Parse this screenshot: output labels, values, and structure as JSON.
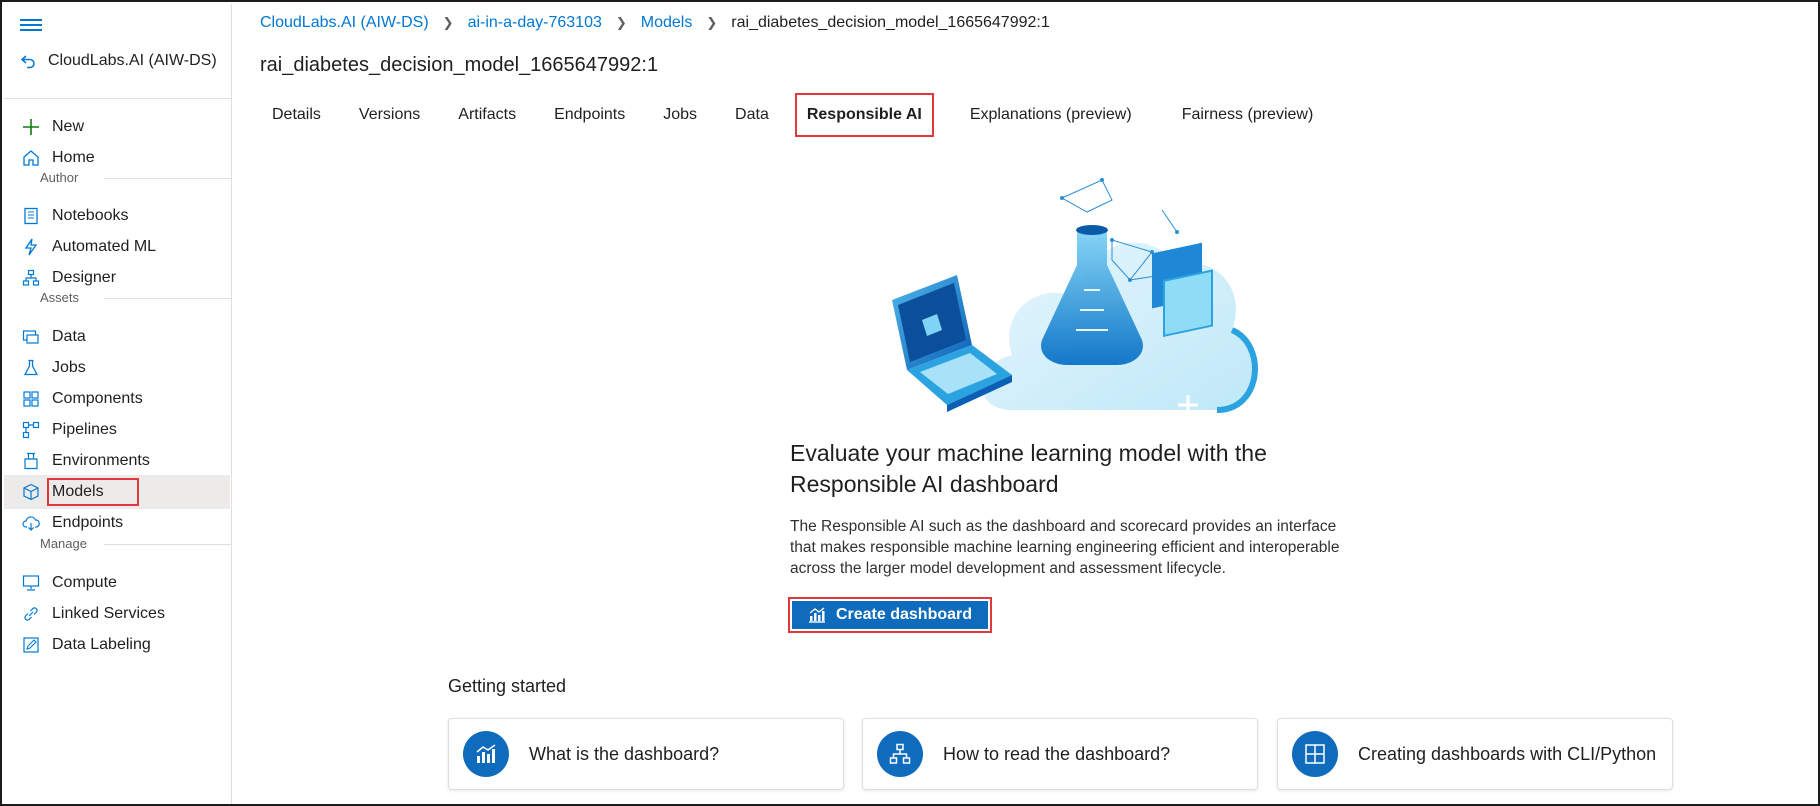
{
  "workspace": {
    "back_label": "CloudLabs.AI (AIW-DS)"
  },
  "sidebar": {
    "new_label": "New",
    "home_label": "Home",
    "section_author": "Author",
    "author_items": [
      "Notebooks",
      "Automated ML",
      "Designer"
    ],
    "section_assets": "Assets",
    "asset_items": [
      "Data",
      "Jobs",
      "Components",
      "Pipelines",
      "Environments",
      "Models",
      "Endpoints"
    ],
    "section_manage": "Manage",
    "manage_items": [
      "Compute",
      "Linked Services",
      "Data Labeling"
    ],
    "active_item": "Models"
  },
  "breadcrumb": {
    "items": [
      "CloudLabs.AI (AIW-DS)",
      "ai-in-a-day-763103",
      "Models"
    ],
    "current": "rai_diabetes_decision_model_1665647992:1"
  },
  "page": {
    "title": "rai_diabetes_decision_model_1665647992:1",
    "tabs": [
      "Details",
      "Versions",
      "Artifacts",
      "Endpoints",
      "Jobs",
      "Data",
      "Responsible AI",
      "Explanations (preview)",
      "Fairness (preview)"
    ],
    "active_tab": "Responsible AI"
  },
  "hero": {
    "heading": "Evaluate your machine learning model with the Responsible AI dashboard",
    "description": "The Responsible AI such as the dashboard and scorecard provides an interface that makes responsible machine learning engineering efficient and interoperable across the larger model development and assessment lifecycle.",
    "cta_label": "Create dashboard"
  },
  "getting_started": {
    "title": "Getting started",
    "cards": [
      "What is the dashboard?",
      "How to read the dashboard?",
      "Creating dashboards with CLI/Python"
    ]
  },
  "colors": {
    "accent": "#0078d4",
    "button": "#0f6cbd",
    "highlight": "#e0383e"
  }
}
